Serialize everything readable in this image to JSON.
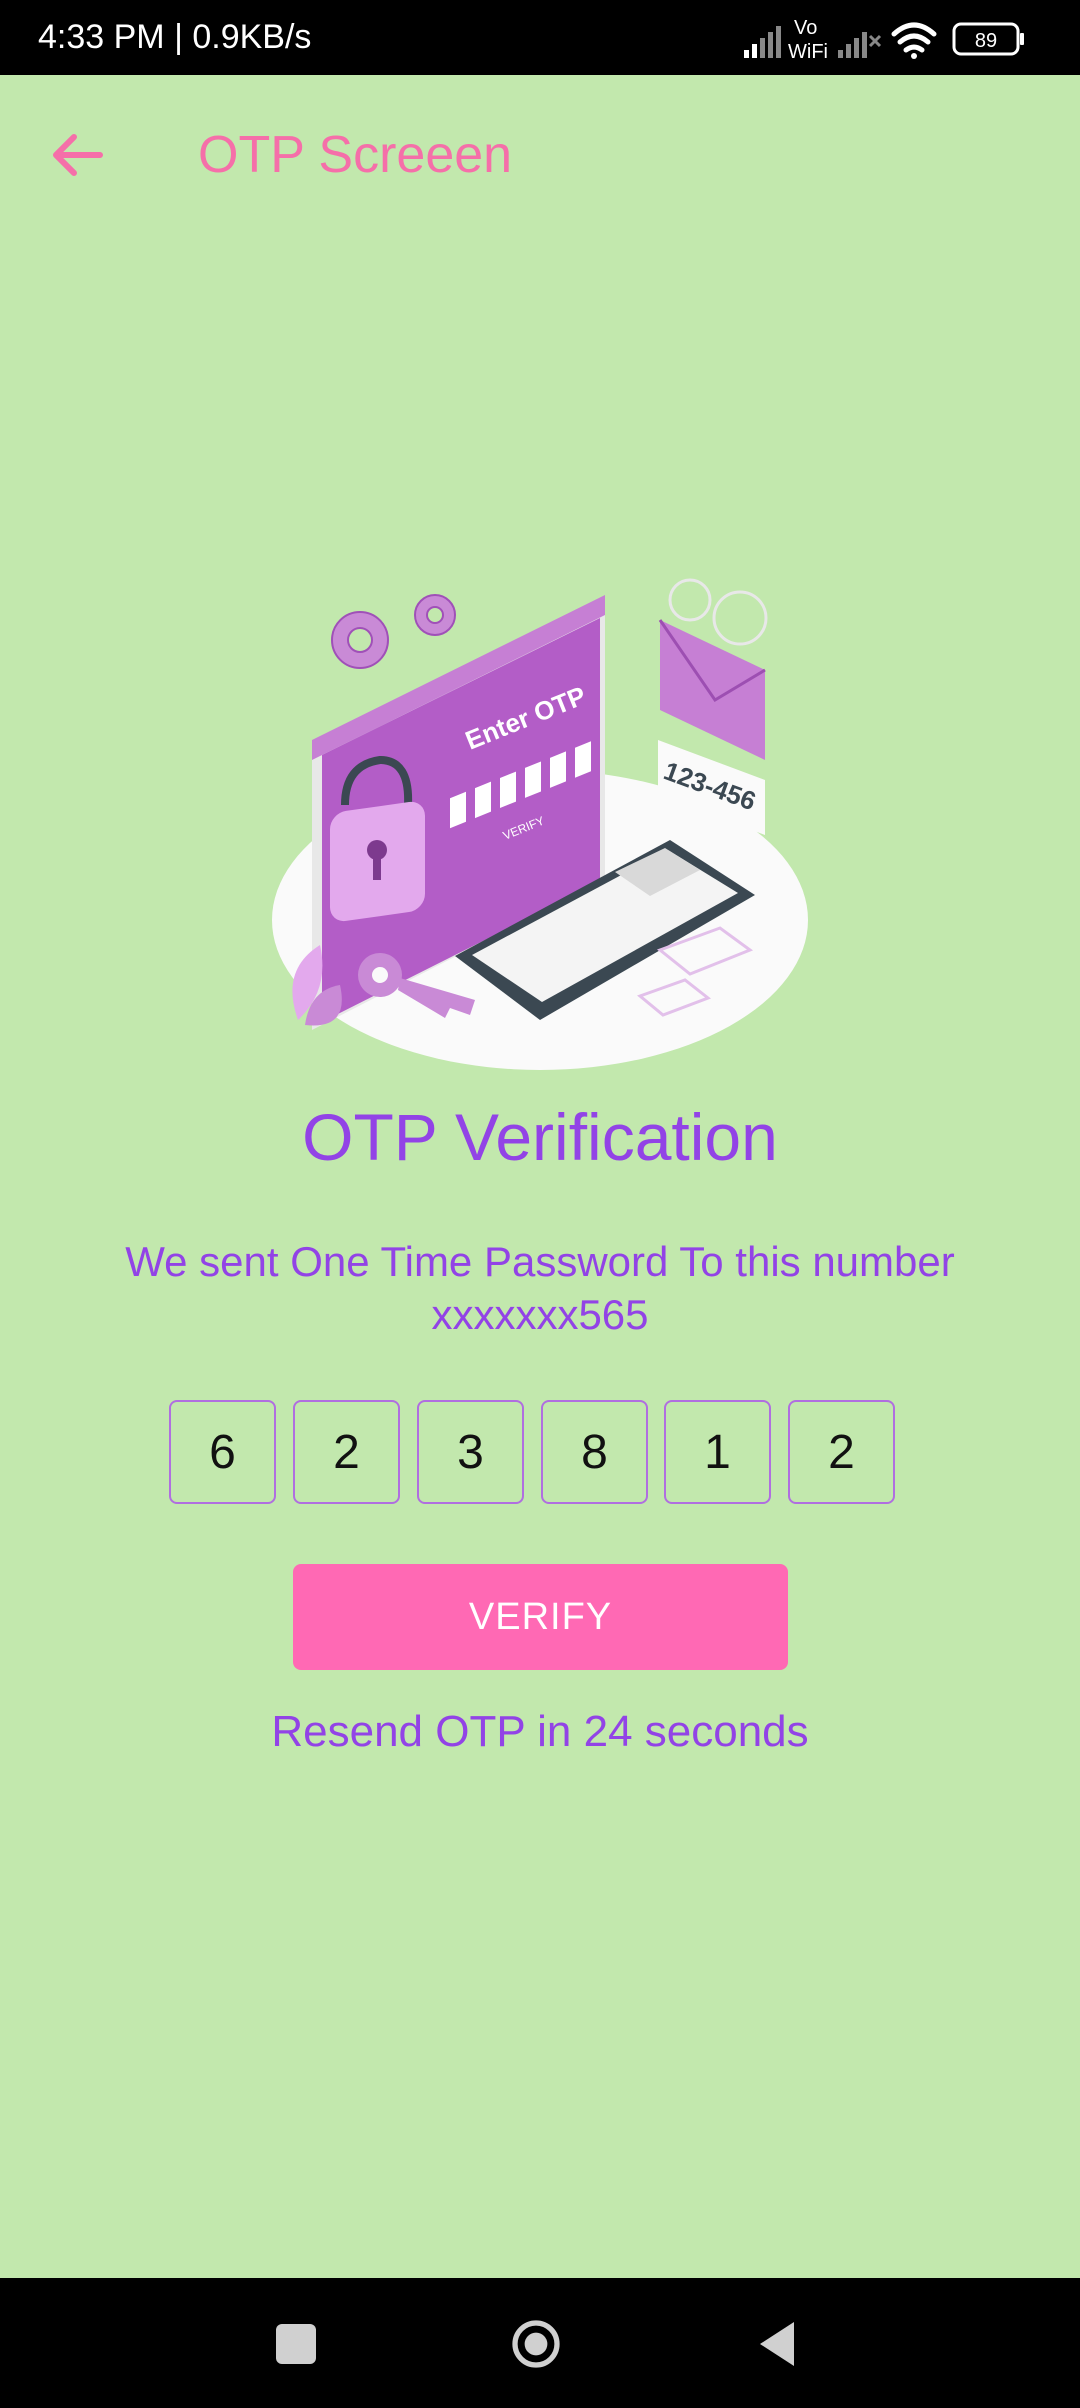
{
  "status_bar": {
    "time_speed": "4:33 PM | 0.9KB/s",
    "wifi_call_label_top": "Vo",
    "wifi_call_label_bottom": "WiFi",
    "battery_level": "89"
  },
  "app_bar": {
    "title": "OTP Screeen",
    "back_icon": "arrow-left-icon"
  },
  "illustration": {
    "header_text": "Enter OTP",
    "verify_text": "VERIFY",
    "bubble_text": "123-456"
  },
  "content": {
    "title": "OTP Verification",
    "message_line1": "We sent One Time Password To this number",
    "message_line2": "xxxxxxx565",
    "otp_digits": [
      "6",
      "2",
      "3",
      "8",
      "1",
      "2"
    ],
    "verify_label": "VERIFY",
    "resend_text": "Resend OTP in 24 seconds"
  },
  "colors": {
    "background": "#c2e8ad",
    "accent_pink": "#f56fa9",
    "button_pink": "#ff69b4",
    "text_purple": "#9243e6",
    "otp_border": "#b06ee0"
  },
  "nav_bar": {
    "icons": [
      "square-recent-icon",
      "circle-home-icon",
      "triangle-back-icon"
    ]
  }
}
